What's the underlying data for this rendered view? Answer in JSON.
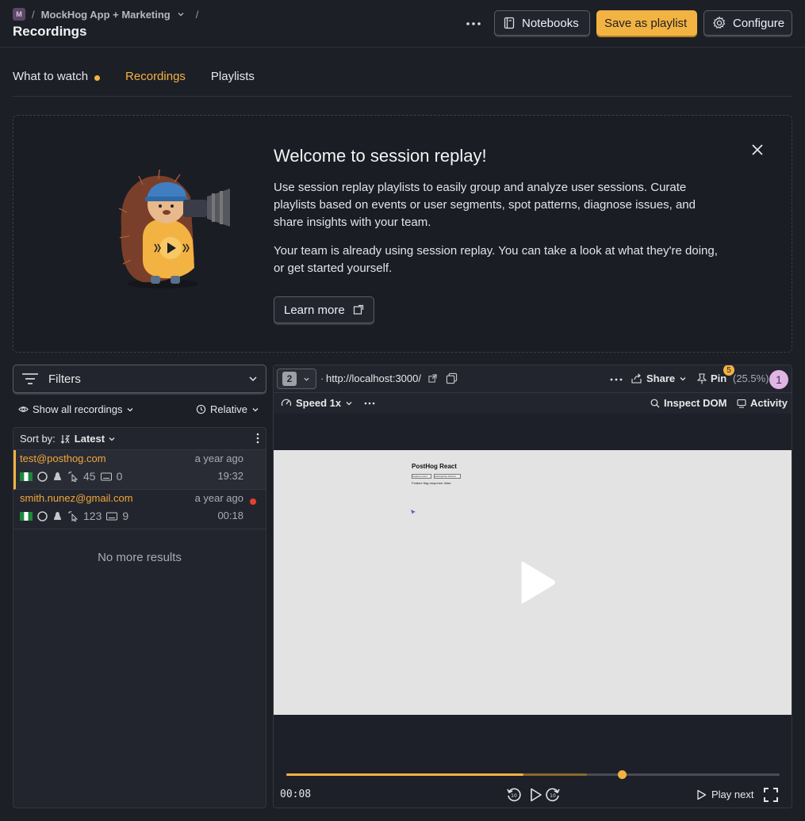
{
  "breadcrumb": {
    "project_initial": "M",
    "project_name": "MockHog App + Marketing"
  },
  "page_title": "Recordings",
  "header_actions": {
    "notebooks": "Notebooks",
    "save_playlist": "Save as playlist",
    "configure": "Configure"
  },
  "tabs": [
    {
      "label": "What to watch",
      "active": false,
      "has_dot": true
    },
    {
      "label": "Recordings",
      "active": true
    },
    {
      "label": "Playlists",
      "active": false
    }
  ],
  "welcome": {
    "title": "Welcome to session replay!",
    "paragraph1": "Use session replay playlists to easily group and analyze user sessions. Curate playlists based on events or user segments, spot patterns, diagnose issues, and share insights with your team.",
    "paragraph2": "Your team is already using session replay. You can take a look at what they're doing, or get started yourself.",
    "learn_more": "Learn more"
  },
  "filters": {
    "label": "Filters",
    "show_all": "Show all recordings",
    "time_mode": "Relative",
    "sort_prefix": "Sort by:",
    "sort_value": "Latest"
  },
  "recordings": [
    {
      "email": "test@posthog.com",
      "time_ago": "a year ago",
      "clicks": "45",
      "keypresses": "0",
      "duration": "19:32",
      "active": true,
      "live": false
    },
    {
      "email": "smith.nunez@gmail.com",
      "time_ago": "a year ago",
      "clicks": "123",
      "keypresses": "9",
      "duration": "00:18",
      "active": false,
      "live": true
    }
  ],
  "no_more_results": "No more results",
  "player": {
    "tab_count": "2",
    "url": "http://localhost:3000/",
    "share": "Share",
    "pin": "Pin",
    "pin_count": "5",
    "percent": "(25.5%)",
    "viewer_count": "1",
    "speed": "Speed 1x",
    "inspect_dom": "Inspect DOM",
    "activity": "Activity",
    "current_time": "00:08",
    "play_next": "Play next",
    "progress_fraction": 0.48,
    "buffered_fraction": 0.61,
    "skip_back_seconds": "10",
    "skip_forward_seconds": "10"
  },
  "mini_page": {
    "title": "PostHog React",
    "button1": "Capture event",
    "button2": "Autocapture buttons",
    "text": "Feature flag response: false"
  },
  "colors": {
    "accent": "#f3b342",
    "background": "#1d1f27",
    "panel": "#23252e",
    "link": "#f3a83a",
    "live": "#e5412d"
  }
}
